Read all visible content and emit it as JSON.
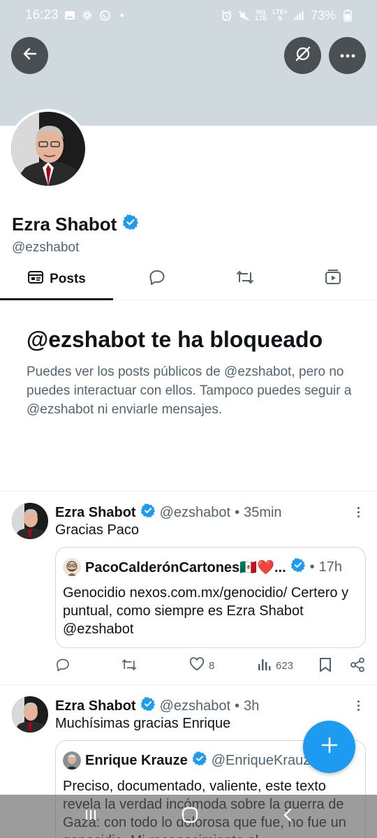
{
  "status_bar": {
    "time": "16:23",
    "network_top": "Vo)",
    "network_bottom": "LTE",
    "lte_label": "LTE+",
    "battery": "73%"
  },
  "profile": {
    "name": "Ezra Shabot",
    "handle": "@ezshabot",
    "verified": true
  },
  "header_buttons": {
    "back": "arrow-left-icon",
    "grok": "grok-icon",
    "more": "more-horizontal-icon"
  },
  "tabs": [
    {
      "label": "Posts",
      "icon": "posts-icon",
      "active": true
    },
    {
      "label": "",
      "icon": "reply-icon",
      "active": false
    },
    {
      "label": "",
      "icon": "repost-icon",
      "active": false
    },
    {
      "label": "",
      "icon": "media-icon",
      "active": false
    }
  ],
  "blocked": {
    "title": "@ezshabot te ha bloqueado",
    "text": "Puedes ver los posts públicos de @ezshabot, pero no puedes interactuar con ellos. Tampoco puedes seguir a @ezshabot ni enviarle mensajes."
  },
  "tweets": [
    {
      "name": "Ezra Shabot",
      "handle": "@ezshabot",
      "time": "35min",
      "text": "Gracias Paco",
      "quote": {
        "name": "PacoCalderónCartones🇲🇽❤️...",
        "time": "17h",
        "text": "Genocidio nexos.com.mx/genocidio/ Certero y puntual, como siempre es Ezra Shabot @ezshabot"
      },
      "likes": "8",
      "views": "623"
    },
    {
      "name": "Ezra Shabot",
      "handle": "@ezshabot",
      "time": "3h",
      "text": "Muchísimas gracias Enrique",
      "quote": {
        "name": "Enrique Krauze",
        "handle": "@EnriqueKrauze",
        "text": "Preciso, documentado, valiente, este texto revela la verdad incómoda sobre la guerra de Gaza: con todo lo dolorosa que fue, no fue un genocidio. Mi reconocimiento al"
      }
    }
  ],
  "separator": "•",
  "colors": {
    "accent": "#1d9bf0",
    "banner": "#cfd9de",
    "muted": "#536471",
    "text": "#0f1419"
  }
}
